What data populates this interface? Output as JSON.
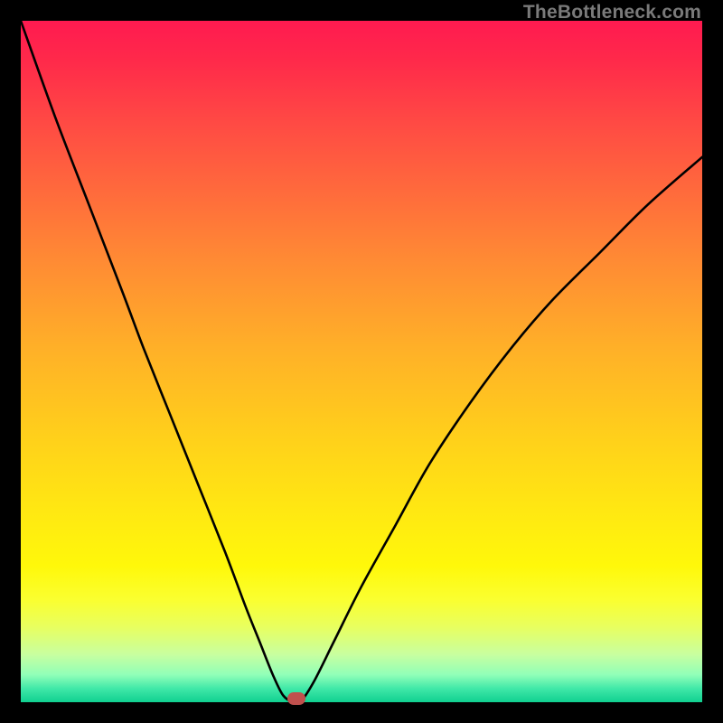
{
  "watermark": "TheBottleneck.com",
  "colors": {
    "frame": "#000000",
    "curve": "#000000",
    "marker": "#c0504d"
  },
  "chart_data": {
    "type": "line",
    "title": "",
    "xlabel": "",
    "ylabel": "",
    "xlim": [
      0,
      100
    ],
    "ylim": [
      0,
      100
    ],
    "grid": false,
    "series": [
      {
        "name": "bottleneck-curve",
        "x": [
          0,
          5,
          10,
          15,
          18,
          22,
          26,
          30,
          33,
          35,
          37,
          38.5,
          40,
          41,
          43,
          46,
          50,
          55,
          60,
          66,
          72,
          78,
          85,
          92,
          100
        ],
        "values": [
          100,
          86,
          73,
          60,
          52,
          42,
          32,
          22,
          14,
          9,
          4,
          1,
          0,
          0,
          3,
          9,
          17,
          26,
          35,
          44,
          52,
          59,
          66,
          73,
          80
        ]
      }
    ],
    "annotations": [
      {
        "name": "optimal-marker",
        "x": 40.5,
        "y": 0.5
      }
    ],
    "background_gradient": {
      "orientation": "vertical",
      "stops": [
        {
          "pos": 0.0,
          "color": "#ff1a50"
        },
        {
          "pos": 0.5,
          "color": "#ffb028"
        },
        {
          "pos": 0.8,
          "color": "#fff80a"
        },
        {
          "pos": 1.0,
          "color": "#10d090"
        }
      ]
    }
  }
}
